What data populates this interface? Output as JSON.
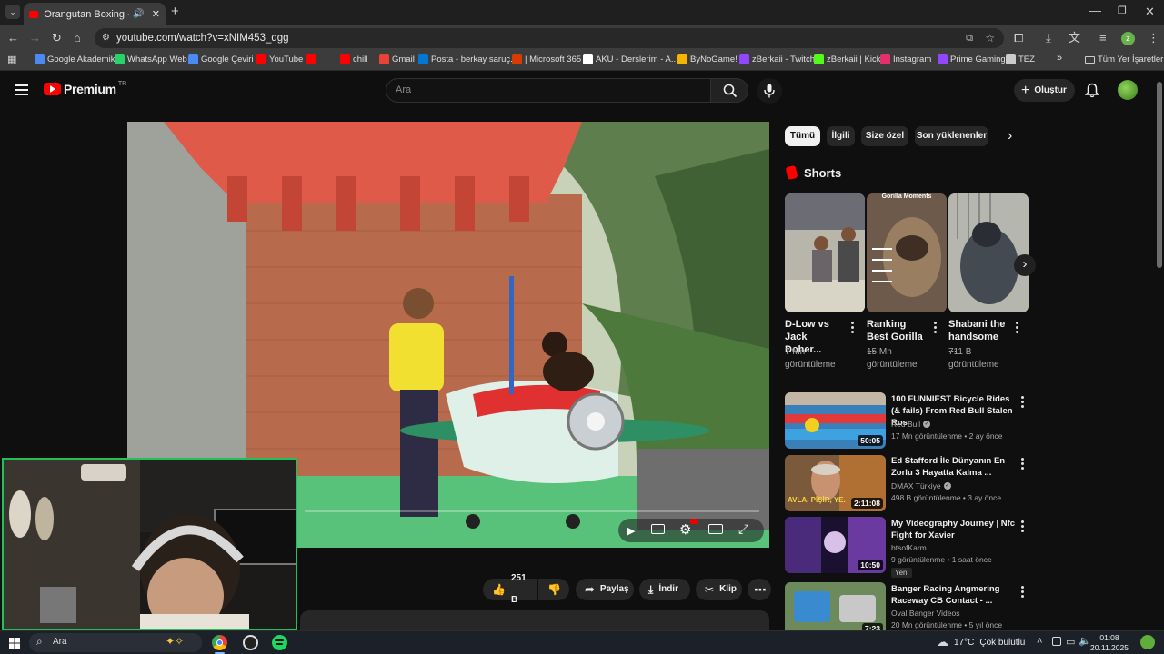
{
  "browser": {
    "tab_title": "Orangutan Boxing - YouTube",
    "url": "youtube.com/watch?v=xNIM453_dgg",
    "bookmarks": [
      {
        "label": "Google Akademik",
        "color": "#4a8af4"
      },
      {
        "label": "WhatsApp Web",
        "color": "#25d366"
      },
      {
        "label": "Google Çeviri",
        "color": "#4a8af4"
      },
      {
        "label": "YouTube",
        "color": "#ff0000"
      },
      {
        "label": "",
        "color": "#ff0000"
      },
      {
        "label": "chill",
        "color": "#ff0000"
      },
      {
        "label": "Gmail",
        "color": "#ea4335"
      },
      {
        "label": "Posta - berkay saruç...",
        "color": "#0078d4"
      },
      {
        "label": "| Microsoft 365",
        "color": "#d83b01"
      },
      {
        "label": "AKU - Derslerim - A...",
        "color": "#ffffff"
      },
      {
        "label": "ByNoGame!",
        "color": "#f5b400"
      },
      {
        "label": "zBerkaii - Twitch",
        "color": "#9146ff"
      },
      {
        "label": "zBerkaii | Kick",
        "color": "#53fc18"
      },
      {
        "label": "Instagram",
        "color": "#e1306c"
      },
      {
        "label": "Prime Gaming",
        "color": "#9146ff"
      },
      {
        "label": "TEZ",
        "color": "#cccccc"
      }
    ],
    "all_bookmarks": "Tüm Yer İşaretleri"
  },
  "youtube": {
    "logo_text": "Premium",
    "logo_region": "TR",
    "search_placeholder": "Ara",
    "create_label": "Oluştur",
    "chips": [
      "Tümü",
      "İlgili",
      "Size özel",
      "Son yüklenenler"
    ],
    "shorts_heading": "Shorts",
    "shorts": [
      {
        "title": "D-Low vs Jack Doher...",
        "views": "7 Mn",
        "views_label": "görüntüleme"
      },
      {
        "title": "Ranking Best Gorilla ...",
        "views": "15 Mn",
        "views_label": "görüntüleme",
        "thumb_caption": "Gorilla Moments"
      },
      {
        "title": "Shabani the handsome ...",
        "views": "711 B",
        "views_label": "görüntüleme"
      }
    ],
    "videos": [
      {
        "title": "100 FUNNIEST Bicycle Rides (& fails) From Red Bull Stalen Ros",
        "channel": "Red Bull",
        "verified": true,
        "meta": "17 Mn görüntülenme • 2 ay önce",
        "duration": "50:05"
      },
      {
        "title": "Ed Stafford İle Dünyanın En Zorlu 3 Hayatta Kalma ...",
        "channel": "DMAX Türkiye",
        "verified": true,
        "meta": "498 B görüntülenme • 3 ay önce",
        "duration": "2:11:08",
        "thumb_caption": "AVLA, PİŞİR, YE."
      },
      {
        "title": "My Videography Journey | Nfc Fight for Xavier",
        "channel": "btsofKarm",
        "verified": false,
        "meta": "9 görüntülenme • 1 saat önce",
        "badge": "Yeni",
        "duration": "10:50"
      },
      {
        "title": "Banger Racing Angmering Raceway CB Contact - ...",
        "channel": "Oval Banger Videos",
        "verified": false,
        "meta": "20 Mn görüntülenme • 5 yıl önce",
        "duration": "7:23"
      }
    ],
    "actions": {
      "likes": "251 B",
      "share": "Paylaş",
      "download": "İndir",
      "clip": "Klip"
    }
  },
  "taskbar": {
    "search_placeholder": "Ara",
    "weather_temp": "17°C",
    "weather_desc": "Çok bulutlu",
    "time": "01:08",
    "date": "20.11.2025"
  }
}
